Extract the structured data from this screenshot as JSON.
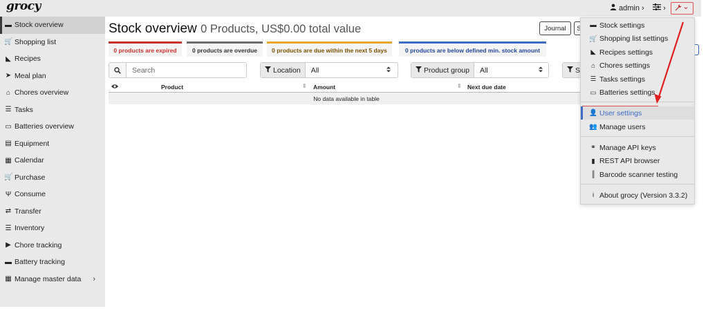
{
  "app": {
    "logo": "grocy"
  },
  "topbar": {
    "user_label": "admin",
    "user_chevron": "›",
    "settings_chevron": "›",
    "wrench_chevron": "⌄"
  },
  "sidebar": {
    "items": [
      {
        "label": "Stock overview",
        "icon": "box-icon",
        "glyph": "▬",
        "active": true
      },
      {
        "label": "Shopping list",
        "icon": "cart-icon",
        "glyph": "🛒"
      },
      {
        "label": "Recipes",
        "icon": "pizza-icon",
        "glyph": "◣"
      },
      {
        "label": "Meal plan",
        "icon": "paper-plane-icon",
        "glyph": "➤"
      },
      {
        "label": "Chores overview",
        "icon": "home-icon",
        "glyph": "⌂"
      },
      {
        "label": "Tasks",
        "icon": "tasks-icon",
        "glyph": "☰"
      },
      {
        "label": "Batteries overview",
        "icon": "battery-icon",
        "glyph": "▭"
      },
      {
        "label": "Equipment",
        "icon": "toolbox-icon",
        "glyph": "▤"
      },
      {
        "label": "Calendar",
        "icon": "calendar-icon",
        "glyph": "▦"
      },
      {
        "label": "Purchase",
        "icon": "cart-plus-icon",
        "glyph": "🛒"
      },
      {
        "label": "Consume",
        "icon": "utensils-icon",
        "glyph": "Ψ"
      },
      {
        "label": "Transfer",
        "icon": "exchange-icon",
        "glyph": "⇄"
      },
      {
        "label": "Inventory",
        "icon": "list-icon",
        "glyph": "☰"
      },
      {
        "label": "Chore tracking",
        "icon": "play-icon",
        "glyph": "▶"
      },
      {
        "label": "Battery tracking",
        "icon": "car-battery-icon",
        "glyph": "▬"
      },
      {
        "label": "Manage master data",
        "icon": "table-icon",
        "glyph": "▦",
        "chevron": "›"
      }
    ]
  },
  "page": {
    "title": "Stock overview",
    "subtitle": "0 Products, US$0.00 total value",
    "journal_button": "Journal",
    "s_button": "S"
  },
  "badges": {
    "expired": "0 products are expired",
    "overdue": "0 products are overdue",
    "due": "0 products are due within the next 5 days",
    "below": "0 products are below defined min. stock amount"
  },
  "filters": {
    "search_placeholder": "Search",
    "location_label": "Location",
    "location_value": "All",
    "product_group_label": "Product group",
    "product_group_value": "All",
    "status_label": "St"
  },
  "table": {
    "columns": [
      "Product",
      "Amount",
      "Next due date"
    ],
    "empty_text": "No data available in table"
  },
  "settings_menu": {
    "items": [
      {
        "label": "Stock settings",
        "icon": "box-icon",
        "glyph": "▬"
      },
      {
        "label": "Shopping list settings",
        "icon": "cart-icon",
        "glyph": "🛒"
      },
      {
        "label": "Recipes settings",
        "icon": "pizza-icon",
        "glyph": "◣"
      },
      {
        "label": "Chores settings",
        "icon": "home-icon",
        "glyph": "⌂"
      },
      {
        "label": "Tasks settings",
        "icon": "tasks-icon",
        "glyph": "☰"
      },
      {
        "label": "Batteries settings",
        "icon": "battery-icon",
        "glyph": "▭"
      },
      {
        "label": "User settings",
        "icon": "user-cog-icon",
        "glyph": "👤",
        "highlight": true
      },
      {
        "label": "Manage users",
        "icon": "users-icon",
        "glyph": "👥"
      },
      {
        "label": "Manage API keys",
        "icon": "handshake-icon",
        "glyph": "⚭"
      },
      {
        "label": "REST API browser",
        "icon": "book-icon",
        "glyph": "▮"
      },
      {
        "label": "Barcode scanner testing",
        "icon": "barcode-icon",
        "glyph": "║"
      },
      {
        "label": "About grocy (Version 3.3.2)",
        "icon": "info-icon",
        "glyph": "i"
      }
    ]
  },
  "colors": {
    "accent_blue": "#3d6cc6",
    "annotation_red": "#e05050",
    "expired_red": "#c9302c",
    "due_orange": "#e8a72b"
  }
}
